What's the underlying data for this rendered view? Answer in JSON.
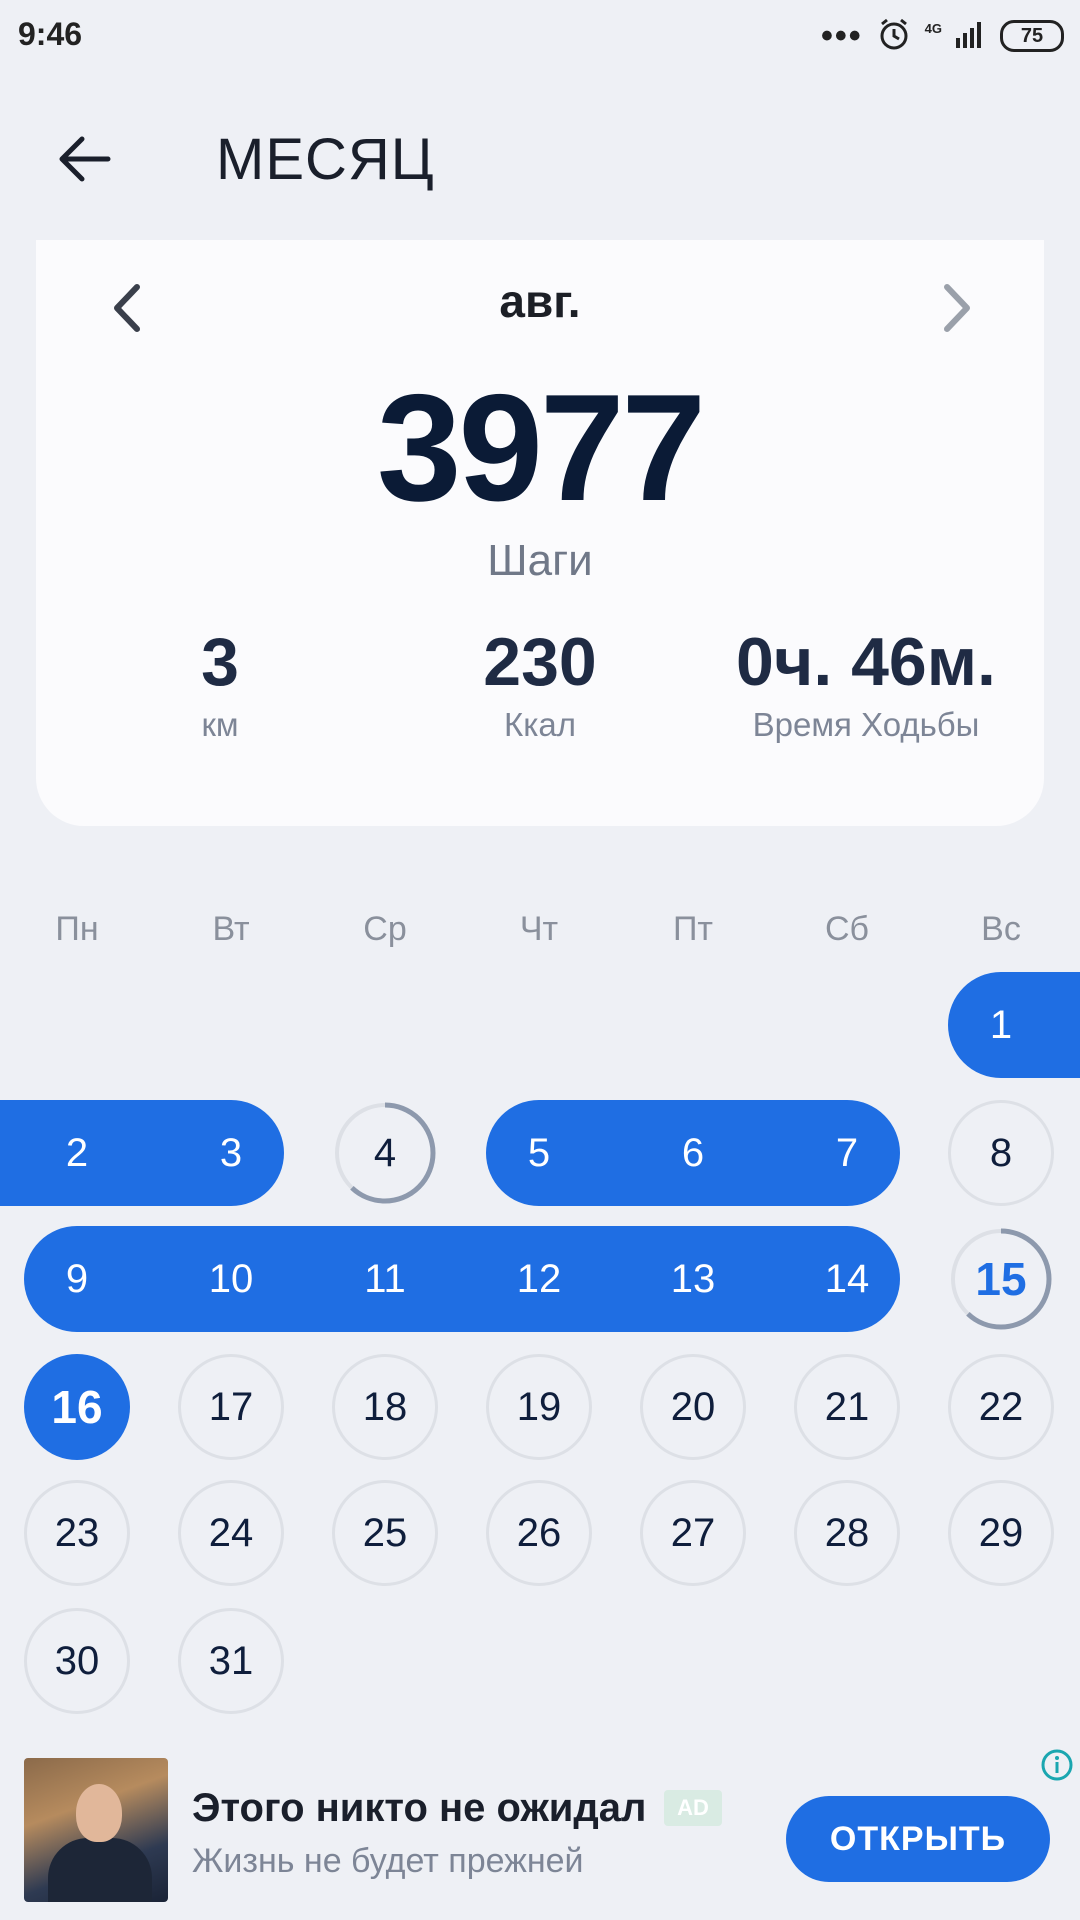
{
  "status": {
    "time": "9:46",
    "network": "4G",
    "battery": "75",
    "dots": "•••"
  },
  "header": {
    "title": "МЕСЯЦ"
  },
  "summary": {
    "month": "авг.",
    "steps": "3977",
    "steps_label": "Шаги",
    "distance_value": "3",
    "distance_unit": "км",
    "calories_value": "230",
    "calories_unit": "Ккал",
    "time_value": "0ч. 46м.",
    "time_label": "Время Ходьбы"
  },
  "calendar": {
    "weekdays": [
      "Пн",
      "Вт",
      "Ср",
      "Чт",
      "Пт",
      "Сб",
      "Вс"
    ],
    "days": [
      {
        "n": "1",
        "state": "done",
        "progress": 1
      },
      {
        "n": "2",
        "state": "done",
        "progress": 1
      },
      {
        "n": "3",
        "state": "done",
        "progress": 1
      },
      {
        "n": "4",
        "state": "partial",
        "progress": 0.62
      },
      {
        "n": "5",
        "state": "done",
        "progress": 1
      },
      {
        "n": "6",
        "state": "done",
        "progress": 1
      },
      {
        "n": "7",
        "state": "done",
        "progress": 1
      },
      {
        "n": "8",
        "state": "empty",
        "progress": 0
      },
      {
        "n": "9",
        "state": "done",
        "progress": 1
      },
      {
        "n": "10",
        "state": "done",
        "progress": 1
      },
      {
        "n": "11",
        "state": "done",
        "progress": 1
      },
      {
        "n": "12",
        "state": "done",
        "progress": 1
      },
      {
        "n": "13",
        "state": "done",
        "progress": 1
      },
      {
        "n": "14",
        "state": "done",
        "progress": 1
      },
      {
        "n": "15",
        "state": "partial",
        "progress": 0.62
      },
      {
        "n": "16",
        "state": "today",
        "progress": 1
      },
      {
        "n": "17",
        "state": "empty",
        "progress": 0
      },
      {
        "n": "18",
        "state": "empty",
        "progress": 0
      },
      {
        "n": "19",
        "state": "empty",
        "progress": 0
      },
      {
        "n": "20",
        "state": "empty",
        "progress": 0
      },
      {
        "n": "21",
        "state": "empty",
        "progress": 0
      },
      {
        "n": "22",
        "state": "empty",
        "progress": 0
      },
      {
        "n": "23",
        "state": "empty",
        "progress": 0
      },
      {
        "n": "24",
        "state": "empty",
        "progress": 0
      },
      {
        "n": "25",
        "state": "empty",
        "progress": 0
      },
      {
        "n": "26",
        "state": "empty",
        "progress": 0
      },
      {
        "n": "27",
        "state": "empty",
        "progress": 0
      },
      {
        "n": "28",
        "state": "empty",
        "progress": 0
      },
      {
        "n": "29",
        "state": "empty",
        "progress": 0
      },
      {
        "n": "30",
        "state": "empty",
        "progress": 0
      },
      {
        "n": "31",
        "state": "empty",
        "progress": 0
      }
    ]
  },
  "ad": {
    "title": "Этого никто не ожидал",
    "badge": "AD",
    "subtitle": "Жизнь не будет прежней",
    "button": "ОТКРЫТЬ",
    "info": "i"
  },
  "colors": {
    "accent": "#1f6ee3",
    "background": "#eef0f5",
    "card": "#fbfbfd",
    "text_dark": "#0b1b36",
    "text_muted": "#7d8596"
  },
  "icons": {
    "back": "arrow-left-icon",
    "prev": "chevron-left-icon",
    "next": "chevron-right-icon",
    "alarm": "alarm-clock-icon",
    "signal": "signal-bars-icon",
    "battery": "battery-icon",
    "info": "info-icon"
  }
}
